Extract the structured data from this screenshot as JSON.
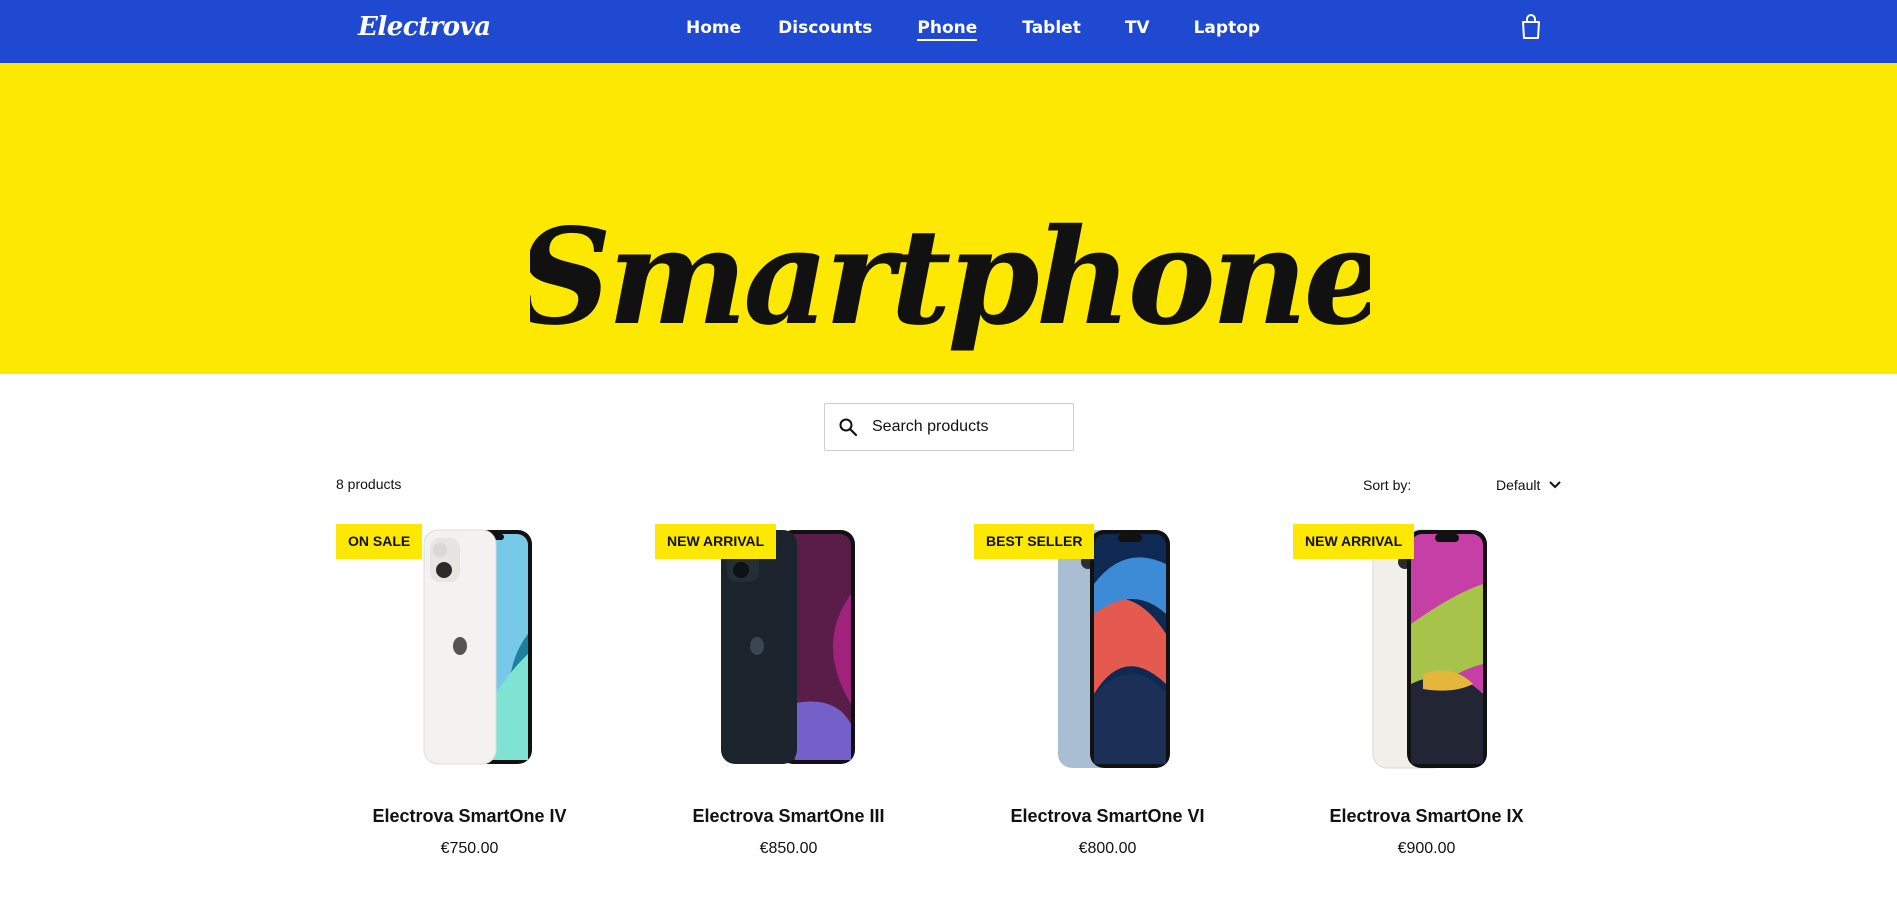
{
  "header": {
    "logo": "Electrova",
    "nav": [
      "Home",
      "Discounts",
      "Phone",
      "Tablet",
      "TV",
      "Laptop"
    ],
    "active_nav": "Phone",
    "cart_icon": "shopping-bag-icon"
  },
  "hero": {
    "title": "Smartphone",
    "background": "#fce800"
  },
  "search": {
    "placeholder": "Search products",
    "icon": "search-icon"
  },
  "listing": {
    "count": "8 products",
    "sort_label": "Sort by:",
    "sort_value": "Default"
  },
  "products": [
    {
      "badge": "ON SALE",
      "name": "Electrova SmartOne IV",
      "price": "€750.00",
      "color": "white"
    },
    {
      "badge": "NEW ARRIVAL",
      "name": "Electrova SmartOne III",
      "price": "€850.00",
      "color": "midnight"
    },
    {
      "badge": "BEST SELLER",
      "name": "Electrova SmartOne VI",
      "price": "€800.00",
      "color": "blue"
    },
    {
      "badge": "NEW ARRIVAL",
      "name": "Electrova SmartOne IX",
      "price": "€900.00",
      "color": "starlight"
    }
  ],
  "colors": {
    "brand_blue": "#1f49d1",
    "badge_yellow": "#fce800"
  }
}
